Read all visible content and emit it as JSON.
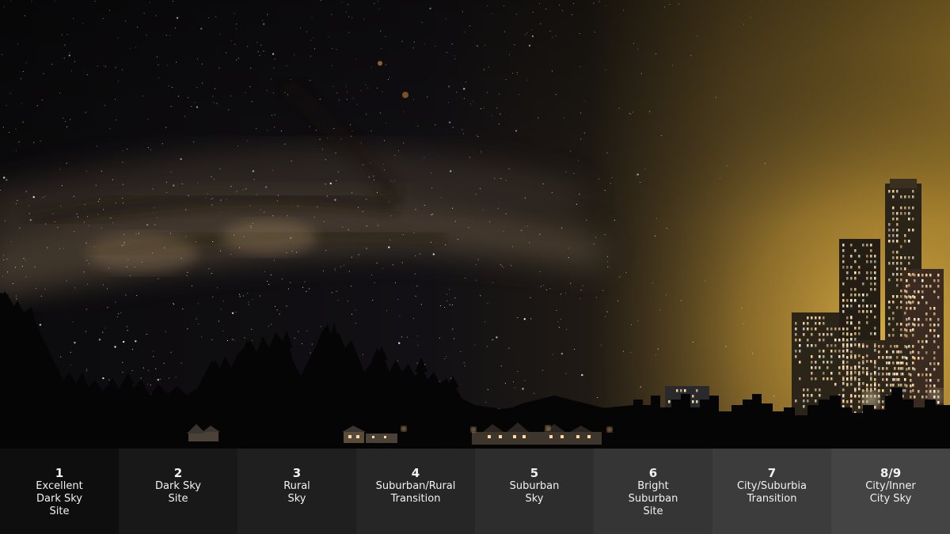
{
  "image": {
    "description_icon": "night-sky-light-pollution-icon",
    "colors": {
      "sky_dark": "#0b0a0c",
      "milky_way_core": "#6b5a45",
      "city_glow": "#b8912f",
      "silhouette": "#050505",
      "window_light": "#ffd9a0"
    }
  },
  "scale": [
    {
      "number": "1",
      "label": "Excellent\nDark Sky\nSite",
      "bg": "#0e0e0e"
    },
    {
      "number": "2",
      "label": "Dark Sky\nSite",
      "bg": "#181818"
    },
    {
      "number": "3",
      "label": "Rural\nSky",
      "bg": "#1f1f1f"
    },
    {
      "number": "4",
      "label": "Suburban/Rural\nTransition",
      "bg": "#262626"
    },
    {
      "number": "5",
      "label": "Suburban\nSky",
      "bg": "#2d2d2d"
    },
    {
      "number": "6",
      "label": "Bright\nSuburban\nSite",
      "bg": "#353535"
    },
    {
      "number": "7",
      "label": "City/Suburbia\nTransition",
      "bg": "#3c3c3c"
    },
    {
      "number": "8/9",
      "label": "City/Inner\nCity Sky",
      "bg": "#444444"
    }
  ]
}
